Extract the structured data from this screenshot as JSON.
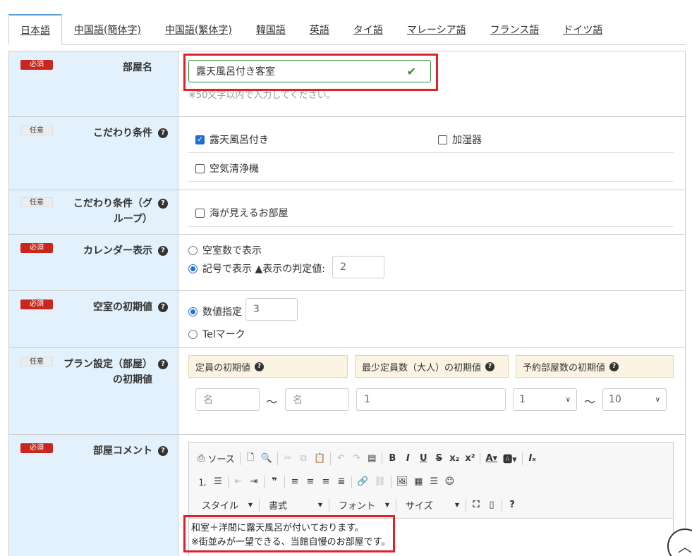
{
  "tabs": [
    {
      "label": "日本語"
    },
    {
      "label": "中国語(簡体字)"
    },
    {
      "label": "中国語(繁体字)"
    },
    {
      "label": "韓国語"
    },
    {
      "label": "英語"
    },
    {
      "label": "タイ語"
    },
    {
      "label": "マレーシア語"
    },
    {
      "label": "フランス語"
    },
    {
      "label": "ドイツ語"
    }
  ],
  "badges": {
    "required": "必須",
    "optional": "任意"
  },
  "room_name": {
    "label": "部屋名",
    "value": "露天風呂付き客室",
    "hint": "※50文字以内で入力してください。"
  },
  "features": {
    "label": "こだわり条件",
    "items": [
      {
        "label": "露天風呂付き",
        "checked": true
      },
      {
        "label": "加湿器",
        "checked": false
      },
      {
        "label": "空気清浄機",
        "checked": false
      }
    ]
  },
  "features_group": {
    "label_line1": "こだわり条件（グ",
    "label_line2": "ループ）",
    "items": [
      {
        "label": "海が見えるお部屋",
        "checked": false
      }
    ]
  },
  "calendar": {
    "label": "カレンダー表示",
    "option_count": "空室数で表示",
    "option_symbol": "記号で表示 ▲表示の判定値:",
    "selected": "symbol",
    "threshold": "2"
  },
  "initial_vacancy": {
    "label": "空室の初期値",
    "option_number": "数値指定",
    "number_value": "3",
    "option_tel": "Telマーク",
    "selected": "number"
  },
  "plan_defaults": {
    "label_line1": "プラン設定（部屋）",
    "label_line2": "の初期値",
    "capacity_header": "定員の初期値",
    "min_adults_header": "最少定員数（大人）の初期値",
    "rooms_header": "予約部屋数の初期値",
    "capacity_min_placeholder": "名",
    "capacity_max_placeholder": "名",
    "min_adults_value": "1",
    "rooms_min": "1",
    "rooms_max": "10",
    "tilde": "～"
  },
  "room_comment": {
    "label": "部屋コメント",
    "toolbar": {
      "source": "ソース",
      "style": "スタイル",
      "format": "書式",
      "font": "フォント",
      "size": "サイズ"
    },
    "body_line1": "和室＋洋間に露天風呂が付いております。",
    "body_line2": "※街並みが一望できる、当館自慢のお部屋です。"
  },
  "colors": {
    "required_badge": "#c9271d",
    "label_bg": "#e3f1fc",
    "highlight_box": "#e0202a",
    "valid_green": "#3c8a3c",
    "accent_blue": "#1e6fd9"
  }
}
